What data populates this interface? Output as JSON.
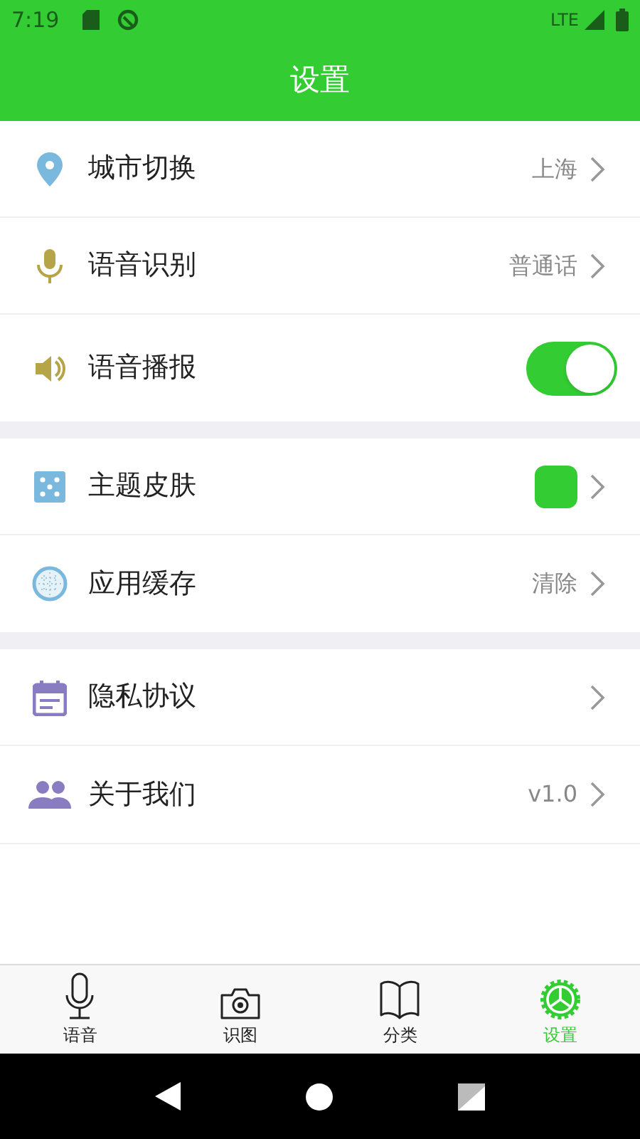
{
  "status_bar": {
    "time": "7:19",
    "network": "LTE"
  },
  "header": {
    "title": "设置"
  },
  "sections": [
    {
      "rows": [
        {
          "kind": "link",
          "label": "城市切换",
          "value": "上海"
        },
        {
          "kind": "link",
          "label": "语音识别",
          "value": "普通话"
        },
        {
          "kind": "toggle",
          "label": "语音播报",
          "on": true
        }
      ]
    },
    {
      "rows": [
        {
          "kind": "swatch",
          "label": "主题皮肤",
          "color": "#33cc33"
        },
        {
          "kind": "link",
          "label": "应用缓存",
          "value": "清除"
        }
      ]
    },
    {
      "rows": [
        {
          "kind": "link",
          "label": "隐私协议"
        },
        {
          "kind": "link",
          "label": "关于我们",
          "value": "v1.0"
        }
      ]
    }
  ],
  "tab_bar": [
    {
      "label": "语音",
      "selected": false
    },
    {
      "label": "识图",
      "selected": false
    },
    {
      "label": "分类",
      "selected": false
    },
    {
      "label": "设置",
      "selected": true
    }
  ]
}
